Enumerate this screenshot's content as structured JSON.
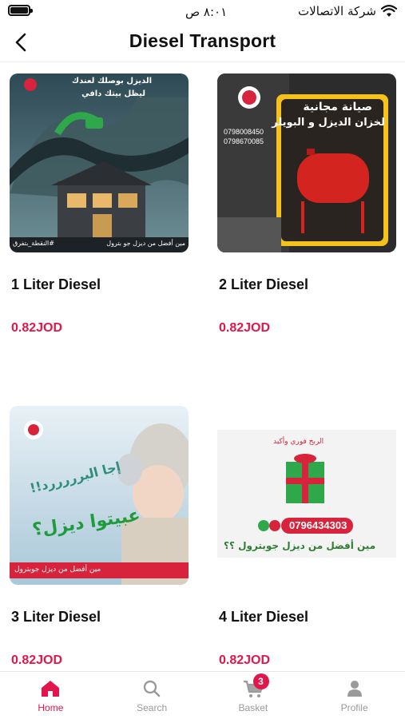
{
  "status_bar": {
    "time": "٨:٠١ ص",
    "carrier": "شركة الاتصالات"
  },
  "header": {
    "title": "Diesel Transport"
  },
  "products": [
    {
      "name": "1 Liter Diesel",
      "price": "0.82JOD",
      "image": {
        "headline1": "الديزل بوصلك لعندك",
        "headline2": "ليظل بيتك دافي",
        "footer": "مين أفضل من ديزل جو بترول",
        "tag": "#النقطة_بتفرق"
      }
    },
    {
      "name": "2 Liter Diesel",
      "price": "0.82JOD",
      "image": {
        "headline1": "صيانة مجانية",
        "headline2": "لخزان الديزل و البويلر",
        "phone1": "0798008450",
        "phone2": "0798670085"
      }
    },
    {
      "name": "3 Liter Diesel",
      "price": "0.82JOD",
      "image": {
        "headline1": "إجا البرررررد!!",
        "headline2": "عبيتوا ديزل؟",
        "footer": "مين أفضل من ديزل جوبترول"
      }
    },
    {
      "name": "4 Liter Diesel",
      "price": "0.82JOD",
      "image": {
        "headline1": "الربح فوري وأكيد",
        "phone": "0796434303",
        "footer": "مين أفضل من ديزل جوبترول ؟؟"
      }
    }
  ],
  "bottom_nav": {
    "items": [
      {
        "label": "Home",
        "icon": "home-icon",
        "active": true
      },
      {
        "label": "Search",
        "icon": "search-icon",
        "active": false
      },
      {
        "label": "Basket",
        "icon": "cart-icon",
        "active": false,
        "badge": "3"
      },
      {
        "label": "Profile",
        "icon": "user-icon",
        "active": false
      }
    ]
  },
  "colors": {
    "accent": "#e2164a",
    "inactive": "#9a9a9a",
    "text": "#111111"
  }
}
